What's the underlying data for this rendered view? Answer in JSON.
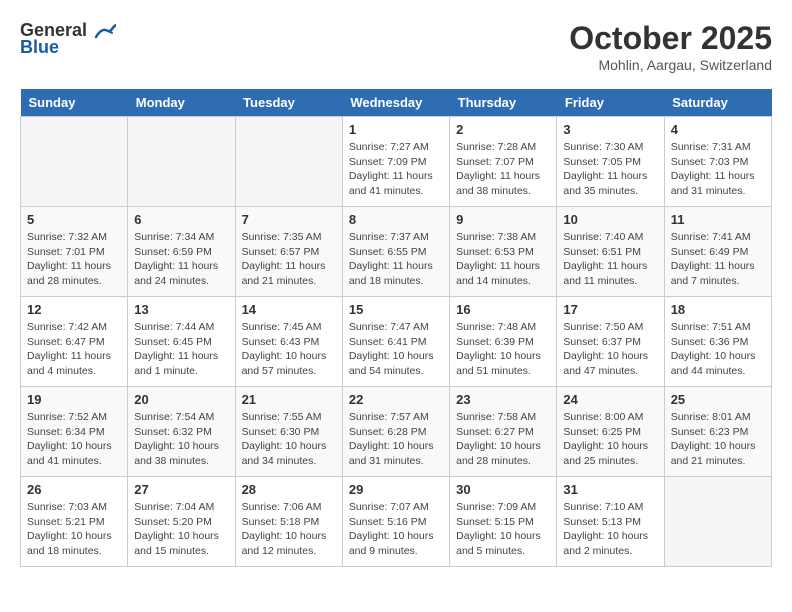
{
  "header": {
    "logo_general": "General",
    "logo_blue": "Blue",
    "month_title": "October 2025",
    "location": "Mohlin, Aargau, Switzerland"
  },
  "weekdays": [
    "Sunday",
    "Monday",
    "Tuesday",
    "Wednesday",
    "Thursday",
    "Friday",
    "Saturday"
  ],
  "weeks": [
    [
      {
        "day": "",
        "info": ""
      },
      {
        "day": "",
        "info": ""
      },
      {
        "day": "",
        "info": ""
      },
      {
        "day": "1",
        "info": "Sunrise: 7:27 AM\nSunset: 7:09 PM\nDaylight: 11 hours\nand 41 minutes."
      },
      {
        "day": "2",
        "info": "Sunrise: 7:28 AM\nSunset: 7:07 PM\nDaylight: 11 hours\nand 38 minutes."
      },
      {
        "day": "3",
        "info": "Sunrise: 7:30 AM\nSunset: 7:05 PM\nDaylight: 11 hours\nand 35 minutes."
      },
      {
        "day": "4",
        "info": "Sunrise: 7:31 AM\nSunset: 7:03 PM\nDaylight: 11 hours\nand 31 minutes."
      }
    ],
    [
      {
        "day": "5",
        "info": "Sunrise: 7:32 AM\nSunset: 7:01 PM\nDaylight: 11 hours\nand 28 minutes."
      },
      {
        "day": "6",
        "info": "Sunrise: 7:34 AM\nSunset: 6:59 PM\nDaylight: 11 hours\nand 24 minutes."
      },
      {
        "day": "7",
        "info": "Sunrise: 7:35 AM\nSunset: 6:57 PM\nDaylight: 11 hours\nand 21 minutes."
      },
      {
        "day": "8",
        "info": "Sunrise: 7:37 AM\nSunset: 6:55 PM\nDaylight: 11 hours\nand 18 minutes."
      },
      {
        "day": "9",
        "info": "Sunrise: 7:38 AM\nSunset: 6:53 PM\nDaylight: 11 hours\nand 14 minutes."
      },
      {
        "day": "10",
        "info": "Sunrise: 7:40 AM\nSunset: 6:51 PM\nDaylight: 11 hours\nand 11 minutes."
      },
      {
        "day": "11",
        "info": "Sunrise: 7:41 AM\nSunset: 6:49 PM\nDaylight: 11 hours\nand 7 minutes."
      }
    ],
    [
      {
        "day": "12",
        "info": "Sunrise: 7:42 AM\nSunset: 6:47 PM\nDaylight: 11 hours\nand 4 minutes."
      },
      {
        "day": "13",
        "info": "Sunrise: 7:44 AM\nSunset: 6:45 PM\nDaylight: 11 hours\nand 1 minute."
      },
      {
        "day": "14",
        "info": "Sunrise: 7:45 AM\nSunset: 6:43 PM\nDaylight: 10 hours\nand 57 minutes."
      },
      {
        "day": "15",
        "info": "Sunrise: 7:47 AM\nSunset: 6:41 PM\nDaylight: 10 hours\nand 54 minutes."
      },
      {
        "day": "16",
        "info": "Sunrise: 7:48 AM\nSunset: 6:39 PM\nDaylight: 10 hours\nand 51 minutes."
      },
      {
        "day": "17",
        "info": "Sunrise: 7:50 AM\nSunset: 6:37 PM\nDaylight: 10 hours\nand 47 minutes."
      },
      {
        "day": "18",
        "info": "Sunrise: 7:51 AM\nSunset: 6:36 PM\nDaylight: 10 hours\nand 44 minutes."
      }
    ],
    [
      {
        "day": "19",
        "info": "Sunrise: 7:52 AM\nSunset: 6:34 PM\nDaylight: 10 hours\nand 41 minutes."
      },
      {
        "day": "20",
        "info": "Sunrise: 7:54 AM\nSunset: 6:32 PM\nDaylight: 10 hours\nand 38 minutes."
      },
      {
        "day": "21",
        "info": "Sunrise: 7:55 AM\nSunset: 6:30 PM\nDaylight: 10 hours\nand 34 minutes."
      },
      {
        "day": "22",
        "info": "Sunrise: 7:57 AM\nSunset: 6:28 PM\nDaylight: 10 hours\nand 31 minutes."
      },
      {
        "day": "23",
        "info": "Sunrise: 7:58 AM\nSunset: 6:27 PM\nDaylight: 10 hours\nand 28 minutes."
      },
      {
        "day": "24",
        "info": "Sunrise: 8:00 AM\nSunset: 6:25 PM\nDaylight: 10 hours\nand 25 minutes."
      },
      {
        "day": "25",
        "info": "Sunrise: 8:01 AM\nSunset: 6:23 PM\nDaylight: 10 hours\nand 21 minutes."
      }
    ],
    [
      {
        "day": "26",
        "info": "Sunrise: 7:03 AM\nSunset: 5:21 PM\nDaylight: 10 hours\nand 18 minutes."
      },
      {
        "day": "27",
        "info": "Sunrise: 7:04 AM\nSunset: 5:20 PM\nDaylight: 10 hours\nand 15 minutes."
      },
      {
        "day": "28",
        "info": "Sunrise: 7:06 AM\nSunset: 5:18 PM\nDaylight: 10 hours\nand 12 minutes."
      },
      {
        "day": "29",
        "info": "Sunrise: 7:07 AM\nSunset: 5:16 PM\nDaylight: 10 hours\nand 9 minutes."
      },
      {
        "day": "30",
        "info": "Sunrise: 7:09 AM\nSunset: 5:15 PM\nDaylight: 10 hours\nand 5 minutes."
      },
      {
        "day": "31",
        "info": "Sunrise: 7:10 AM\nSunset: 5:13 PM\nDaylight: 10 hours\nand 2 minutes."
      },
      {
        "day": "",
        "info": ""
      }
    ]
  ]
}
